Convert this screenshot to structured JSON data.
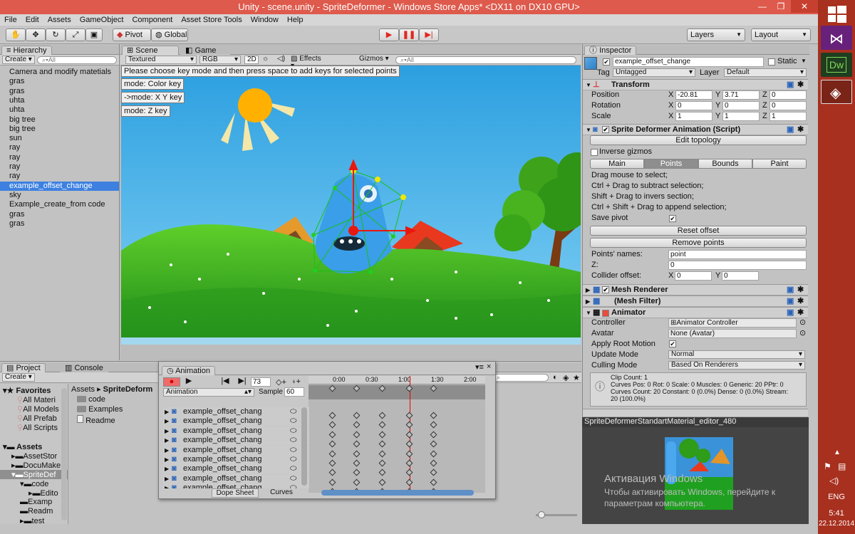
{
  "window": {
    "title": "Unity - scene.unity - SpriteDeformer - Windows Store Apps* <DX11 on DX10 GPU>",
    "minimize_glyph": "—",
    "restore_glyph": "❐",
    "close_glyph": "✕"
  },
  "menu": [
    "File",
    "Edit",
    "Assets",
    "GameObject",
    "Component",
    "Asset Store Tools",
    "Window",
    "Help"
  ],
  "toolbar": {
    "pivot": "Pivot",
    "global": "Global",
    "layers": "Layers",
    "layout": "Layout"
  },
  "hierarchy": {
    "tab": "Hierarchy",
    "create": "Create",
    "search_placeholder": "All",
    "items": [
      "Camera and modify matetials",
      "gras",
      "gras",
      "uhta",
      "uhta",
      "big tree",
      "big tree",
      "sun",
      "ray",
      "ray",
      "ray",
      "ray",
      "example_offset_change",
      "sky",
      "Example_create_from code",
      "gras",
      "gras"
    ],
    "selected_index": 12
  },
  "scene": {
    "tab_scene": "Scene",
    "tab_game": "Game",
    "render_mode": "Textured",
    "color_mode": "RGB",
    "mode_2d": "2D",
    "effects": "Effects",
    "gizmos": "Gizmos",
    "search_placeholder": "All",
    "hint": "Please choose key mode and then press space to add keys for selected points",
    "mode_color": "mode: Color key",
    "mode_xy": "->mode: X Y key",
    "mode_z": "mode: Z key"
  },
  "inspector": {
    "tab": "Inspector",
    "object_name": "example_offset_change",
    "static_label": "Static",
    "tag_label": "Tag",
    "tag_value": "Untagged",
    "layer_label": "Layer",
    "layer_value": "Default",
    "transform": {
      "title": "Transform",
      "position_label": "Position",
      "rotation_label": "Rotation",
      "scale_label": "Scale",
      "position": {
        "x": "-20.81",
        "y": "3.71",
        "z": "0"
      },
      "rotation": {
        "x": "0",
        "y": "0",
        "z": "0"
      },
      "scale": {
        "x": "1",
        "y": "1",
        "z": "1"
      }
    },
    "sprite_deformer": {
      "title": "Sprite Deformer Animation (Script)",
      "edit_topology": "Edit topology",
      "inverse_gizmos": "Inverse gizmos",
      "tabs": [
        "Main",
        "Points",
        "Bounds",
        "Paint"
      ],
      "active_tab": 1,
      "help_lines": [
        "Drag mouse to select;",
        "Ctrl + Drag to subtract selection;",
        "Shift + Drag to invers section;",
        "Ctrl + Shift + Drag to append selection;"
      ],
      "save_pivot": "Save pivot",
      "reset_offset": "Reset offset",
      "remove_points": "Remove points",
      "points_names_label": "Points' names:",
      "points_names_value": "point",
      "z_label": "Z:",
      "z_value": "0",
      "collider_offset_label": "Collider offset:",
      "collider_x": "0",
      "collider_y": "0"
    },
    "mesh_renderer": "Mesh Renderer",
    "mesh_filter": "(Mesh Filter)",
    "animator": {
      "title": "Animator",
      "controller_label": "Controller",
      "controller_value": "Animator Controller",
      "avatar_label": "Avatar",
      "avatar_value": "None (Avatar)",
      "root_motion_label": "Apply Root Motion",
      "update_mode_label": "Update Mode",
      "update_mode_value": "Normal",
      "culling_label": "Culling Mode",
      "culling_value": "Based On Renderers",
      "info": [
        "Clip Count: 1",
        "Curves Pos: 0 Rot: 0 Scale: 0 Muscles: 0 Generic: 20 PPtr: 0",
        "Curves Count: 20 Constant: 0 (0.0%) Dense: 0 (0.0%) Stream:",
        "20 (100.0%)"
      ]
    },
    "preview_title": "SpriteDeformerStandartMaterial_editor_480"
  },
  "activation": {
    "title": "Активация Windows",
    "line1": "Чтобы активировать Windows, перейдите к",
    "line2": "параметрам компьютера."
  },
  "project": {
    "tab_project": "Project",
    "tab_console": "Console",
    "create": "Create",
    "favorites_label": "Favorites",
    "favorites": [
      "All Materi",
      "All Models",
      "All Prefab",
      "All Scripts"
    ],
    "assets_label": "Assets",
    "tree": [
      "AssetStor",
      "DocuMake",
      "SpriteDef",
      "code",
      "Edito",
      "Examp",
      "Readm",
      "test"
    ],
    "breadcrumb_root": "Assets",
    "breadcrumb_current": "SpriteDeform",
    "files": [
      "code",
      "Examples",
      "Readme"
    ]
  },
  "animation": {
    "tab": "Animation",
    "frame": "73",
    "clip_label": "Animation",
    "sample_label": "Sample",
    "sample_value": "60",
    "times": [
      "0:00",
      "0:30",
      "1:00",
      "1:30",
      "2:00"
    ],
    "rows": [
      "example_offset_chang",
      "example_offset_chang",
      "example_offset_chang",
      "example_offset_chang",
      "example_offset_chang",
      "example_offset_chang",
      "example_offset_chang",
      "example_offset_chang",
      "example_offset_chang"
    ],
    "dope_sheet": "Dope Sheet",
    "curves": "Curves"
  },
  "taskbar": {
    "lang": "ENG",
    "time": "5:41",
    "date": "22.12.2014",
    "dw_label": "Dw"
  },
  "colors": {
    "titlebar": "#de5a4c",
    "selection": "#3d80e0",
    "play_red": "#e0281e",
    "taskbar": "#a8301f",
    "sky": "#3eaee6"
  }
}
